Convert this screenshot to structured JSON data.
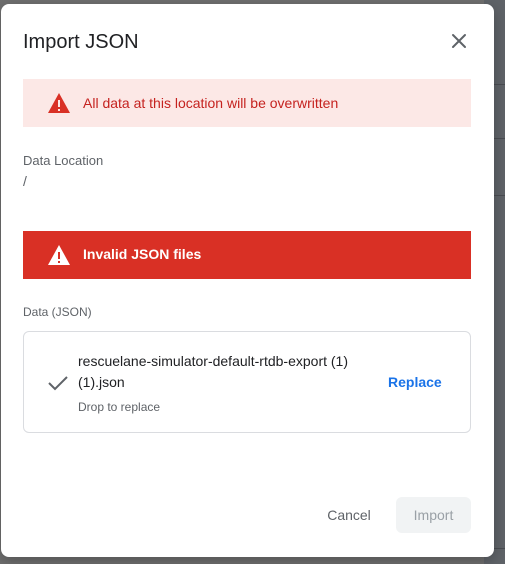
{
  "dialog": {
    "title": "Import JSON",
    "close_icon": "close-icon"
  },
  "warning_banner": {
    "icon": "warning-icon",
    "text": "All data at this location will be overwritten",
    "background": "#fce8e6",
    "text_color": "#c5221f"
  },
  "data_location": {
    "label": "Data Location",
    "value": "/"
  },
  "error_banner": {
    "icon": "warning-icon",
    "text": "Invalid JSON files",
    "background": "#d93025",
    "text_color": "#ffffff"
  },
  "data_section": {
    "label": "Data (JSON)",
    "file_name": "rescuelane-simulator-default-rtdb-export (1) (1).json",
    "hint": "Drop to replace",
    "status_icon": "check-icon",
    "replace_label": "Replace"
  },
  "actions": {
    "cancel_label": "Cancel",
    "import_label": "Import",
    "accent_color": "#1a73e8"
  }
}
